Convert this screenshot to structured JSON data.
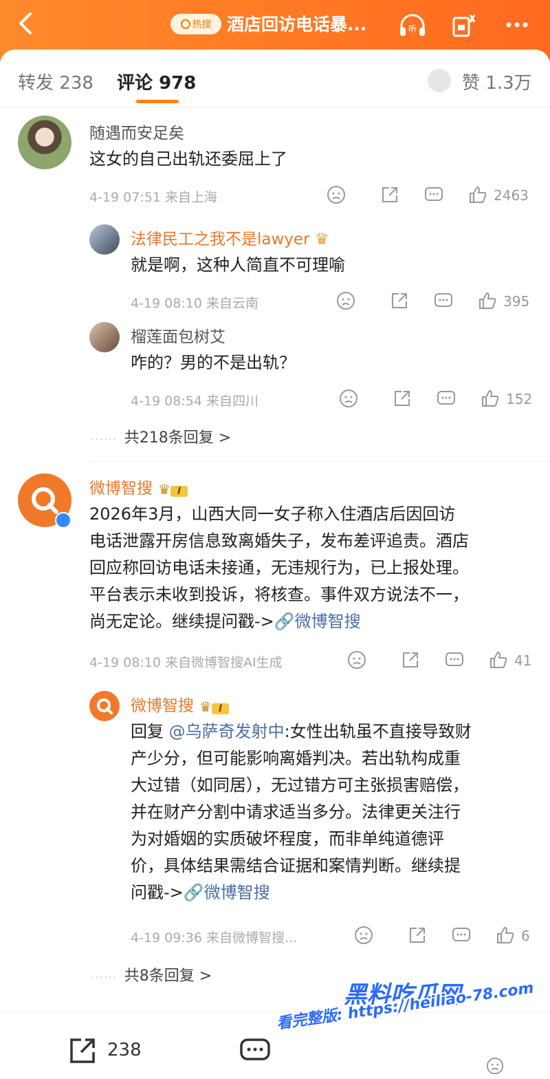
{
  "header": {
    "hot_label": "热搜",
    "title": "酒店回访电话暴...",
    "colors": {
      "accent": "#ff7a1f",
      "link": "#e8792b"
    }
  },
  "tabs": {
    "repost_label": "转发",
    "repost_count": "238",
    "comment_label": "评论",
    "comment_count": "978",
    "like_label": "赞",
    "like_count": "1.3万"
  },
  "comments": [
    {
      "user": "随遇而安足矣",
      "text": "这女的自己出轨还委屈上了",
      "time": "4-19 07:51",
      "location": "来自上海",
      "likes": "2463",
      "replies": [
        {
          "user": "法律民工之我不是lawyer",
          "text": "就是啊，这种人简直不可理喻",
          "time": "4-19 08:10",
          "location": "来自云南",
          "likes": "395"
        },
        {
          "user": "榴莲面包树艾",
          "text": "咋的？男的不是出轨？",
          "time": "4-19 08:54",
          "location": "来自四川",
          "likes": "152"
        }
      ],
      "more_replies": "共218条回复 >"
    },
    {
      "user": "微博智搜",
      "vip_label": "I",
      "text_lines": [
        "2026年3月，山西大同一女子称入住酒店后因回访",
        "电话泄露开房信息致离婚失子，发布差评追责。酒店",
        "回应称回访电话未接通，无违规行为，已上报处理。",
        "平台表示未收到投诉，将核查。事件双方说法不一，",
        "尚无定论。继续提问戳->"
      ],
      "link_text": "微博智搜",
      "time": "4-19 08:10",
      "location": "来自微博智搜AI生成",
      "likes": "41",
      "reply": {
        "user": "微博智搜",
        "vip_label": "I",
        "reply_prefix": "回复",
        "mention": "@乌萨奇发射中",
        "text_lines": [
          ":女性出轨虽不直接导致财",
          "产少分，但可能影响离婚判决。若出轨构成重",
          "大过错（如同居），无过错方可主张损害赔偿，",
          "并在财产分割中请求适当多分。法律更关注行",
          "为对婚姻的实质破坏程度，而非单纯道德评",
          "价，具体结果需结合证据和案情判断。继续提",
          "问戳->"
        ],
        "link_text": "微博智搜",
        "time": "4-19 09:36",
        "location": "来自微博智搜...",
        "likes": "6"
      },
      "more_replies": "共8条回复 >"
    }
  ],
  "bottombar": {
    "repost_count": "238"
  },
  "watermark": {
    "line1": "黑料吃瓜网",
    "line2": "看完整版: https://heiliao-78.com"
  }
}
